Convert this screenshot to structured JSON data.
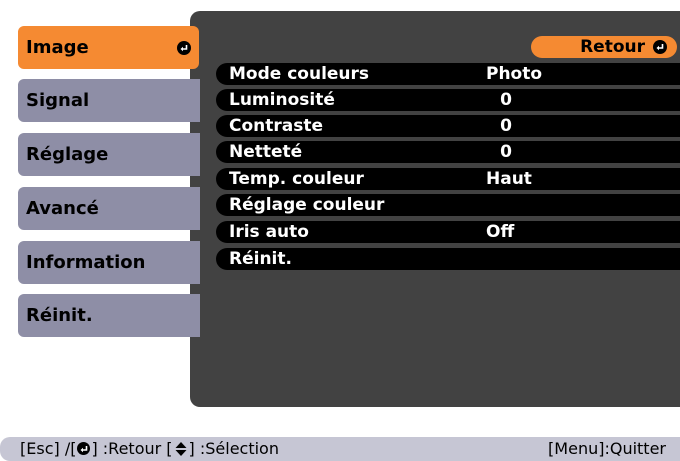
{
  "sidebar": {
    "items": [
      {
        "label": "Image",
        "active": true
      },
      {
        "label": "Signal"
      },
      {
        "label": "Réglage"
      },
      {
        "label": "Avancé"
      },
      {
        "label": "Information"
      },
      {
        "label": "Réinit."
      }
    ]
  },
  "main": {
    "back_label": "Retour",
    "rows": [
      {
        "label": "Mode couleurs",
        "value": "Photo"
      },
      {
        "label": "Luminosité",
        "value": "0"
      },
      {
        "label": "Contraste",
        "value": "0"
      },
      {
        "label": "Netteté",
        "value": "0"
      },
      {
        "label": "Temp. couleur",
        "value": "Haut"
      },
      {
        "label": "Réglage couleur",
        "value": ""
      },
      {
        "label": "Iris auto",
        "value": "Off"
      },
      {
        "label": "Réinit.",
        "value": ""
      }
    ]
  },
  "footer": {
    "esc": "[Esc] /[",
    "retour": "] :Retour  [",
    "selection": "] :Sélection",
    "quit": "[Menu]:Quitter"
  },
  "colors": {
    "accent": "#f58a32",
    "tab": "#8e8ea6",
    "panel": "#424242",
    "row": "#000000",
    "footer": "#c6c6d4"
  },
  "icons": {
    "enter": "enter-icon",
    "updown": "up-down-arrow-icon"
  }
}
